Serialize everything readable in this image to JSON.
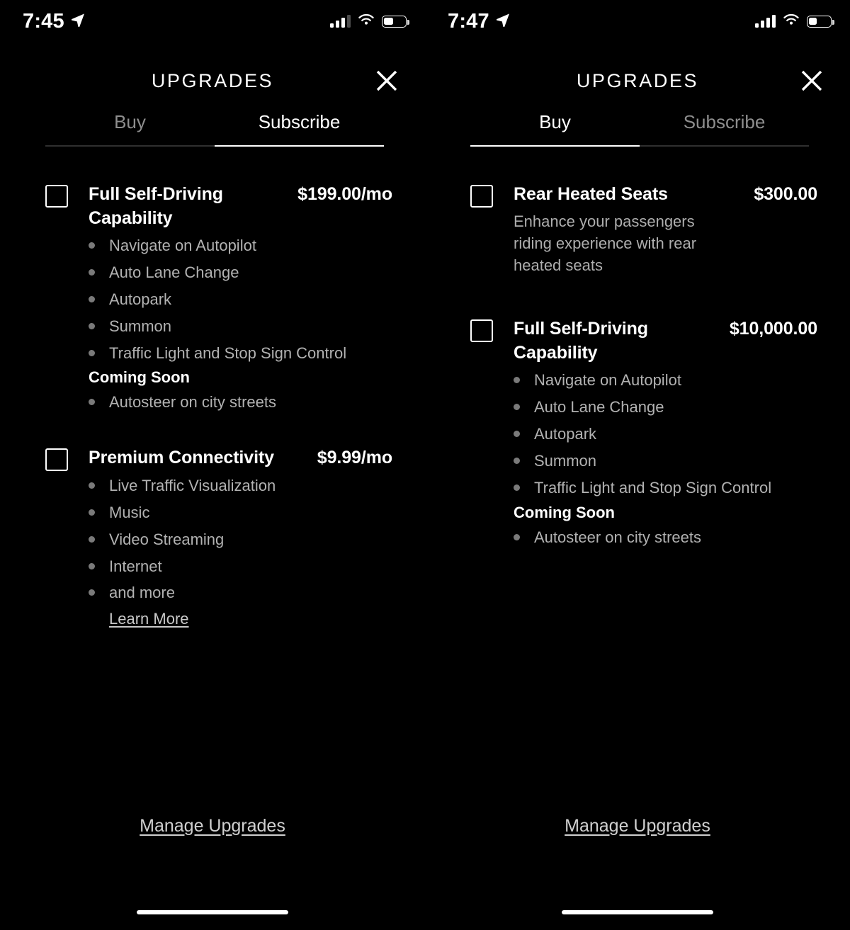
{
  "panels": [
    {
      "status": {
        "time": "7:45",
        "location_icon": "location-arrow-icon",
        "cell_icon": "cellular-signal-icon",
        "cell_bars_filled": 3,
        "wifi_icon": "wifi-icon",
        "battery_icon": "battery-icon",
        "battery_level": 42
      },
      "header": {
        "title": "UPGRADES",
        "close_icon": "close-icon"
      },
      "tabs": [
        {
          "label": "Buy",
          "active": false
        },
        {
          "label": "Subscribe",
          "active": true
        }
      ],
      "items": [
        {
          "checkbox": "unchecked",
          "title": "Full Self-Driving Capability",
          "price": "$199.00/mo",
          "description": "",
          "features": [
            "Navigate on Autopilot",
            "Auto Lane Change",
            "Autopark",
            "Summon",
            "Traffic Light and Stop Sign Control"
          ],
          "coming_soon_label": "Coming Soon",
          "coming_soon_features": [
            "Autosteer on city streets"
          ],
          "learn_more": ""
        },
        {
          "checkbox": "unchecked",
          "title": "Premium Connectivity",
          "price": "$9.99/mo",
          "description": "",
          "features": [
            "Live Traffic Visualization",
            "Music",
            "Video Streaming",
            "Internet",
            "and more"
          ],
          "coming_soon_label": "",
          "coming_soon_features": [],
          "learn_more": "Learn More"
        }
      ],
      "footer": {
        "manage_label": "Manage Upgrades",
        "home_indicator": "home-indicator"
      }
    },
    {
      "status": {
        "time": "7:47",
        "location_icon": "location-arrow-icon",
        "cell_icon": "cellular-signal-icon",
        "cell_bars_filled": 4,
        "wifi_icon": "wifi-icon",
        "battery_icon": "battery-icon",
        "battery_level": 36
      },
      "header": {
        "title": "UPGRADES",
        "close_icon": "close-icon"
      },
      "tabs": [
        {
          "label": "Buy",
          "active": true
        },
        {
          "label": "Subscribe",
          "active": false
        }
      ],
      "items": [
        {
          "checkbox": "unchecked",
          "title": "Rear Heated Seats",
          "price": "$300.00",
          "description": "Enhance your passengers riding experience with rear heated seats",
          "features": [],
          "coming_soon_label": "",
          "coming_soon_features": [],
          "learn_more": ""
        },
        {
          "checkbox": "unchecked",
          "title": "Full Self-Driving Capability",
          "price": "$10,000.00",
          "description": "",
          "features": [
            "Navigate on Autopilot",
            "Auto Lane Change",
            "Autopark",
            "Summon",
            "Traffic Light and Stop Sign Control"
          ],
          "coming_soon_label": "Coming Soon",
          "coming_soon_features": [
            "Autosteer on city streets"
          ],
          "learn_more": ""
        }
      ],
      "footer": {
        "manage_label": "Manage Upgrades",
        "home_indicator": "home-indicator"
      }
    }
  ],
  "colors": {
    "background": "#000000",
    "text_primary": "#ffffff",
    "text_secondary": "#b2b2b2",
    "text_inactive": "#8e8e8e",
    "bullet": "#7a7a7a",
    "underline_active": "#ffffff",
    "underline_inactive": "#2f2f2f"
  }
}
